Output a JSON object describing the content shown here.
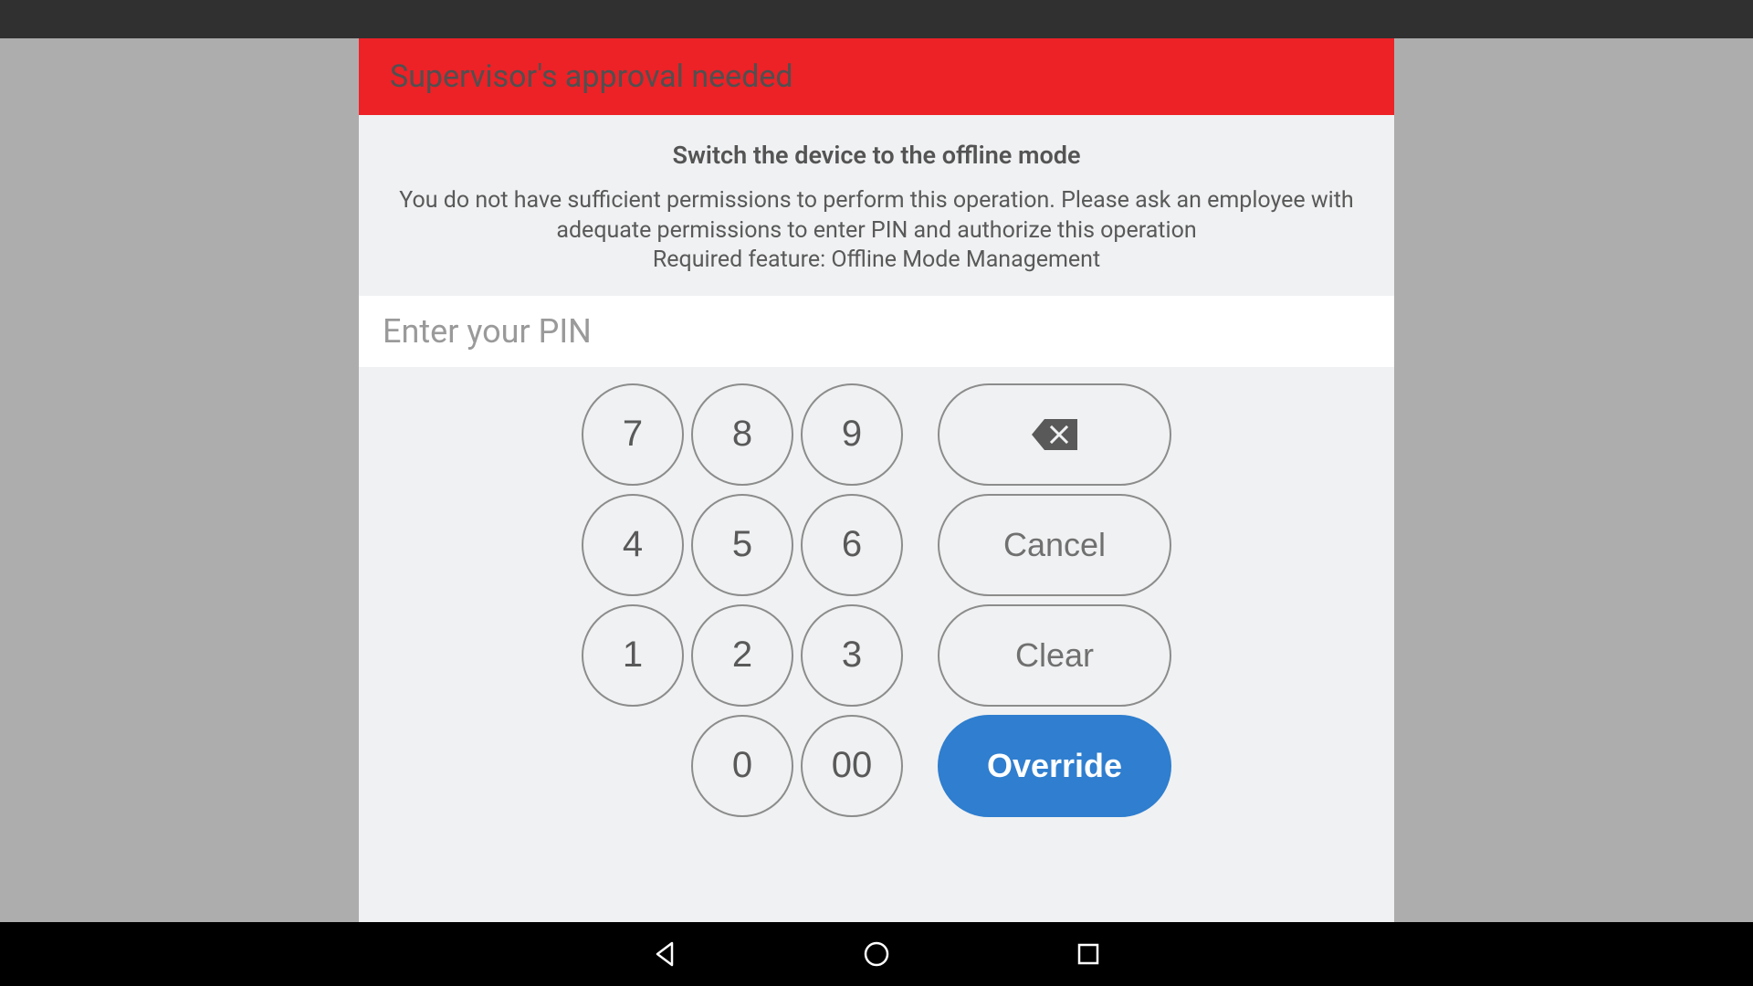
{
  "header": {
    "title": "Supervisor's approval needed"
  },
  "body": {
    "title": "Switch the device to the offline mode",
    "message_line1": "You do not have sufficient permissions to perform this operation. Please ask an employee with",
    "message_line2": "adequate permissions to enter PIN and authorize this operation",
    "message_line3": "Required feature: Offline Mode Management"
  },
  "pin_input": {
    "placeholder": "Enter your PIN",
    "value": ""
  },
  "keypad": {
    "key_7": "7",
    "key_8": "8",
    "key_9": "9",
    "key_4": "4",
    "key_5": "5",
    "key_6": "6",
    "key_1": "1",
    "key_2": "2",
    "key_3": "3",
    "key_0": "0",
    "key_00": "00",
    "cancel_label": "Cancel",
    "clear_label": "Clear",
    "override_label": "Override"
  },
  "icons": {
    "backspace": "backspace-icon",
    "nav_back": "back-icon",
    "nav_home": "home-icon",
    "nav_recent": "recent-icon"
  }
}
